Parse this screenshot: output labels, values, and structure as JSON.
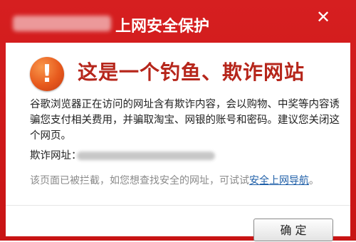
{
  "dialog": {
    "title": "上网安全保护",
    "close_icon": "✕",
    "warning_icon": "!",
    "heading": "这是一个钓鱼、欺诈网站",
    "description": "谷歌浏览器正在访问的网址含有欺诈内容，会以购物、中奖等内容诱骗您支付相关费用，并骗取淘宝、网银的账号和密码。建议您关闭这个网页。",
    "url_label": "欺诈网址：",
    "blocked_text": "该页面已被拦截，如您想查找安全的网址，可试试",
    "safe_nav_link": "安全上网导航",
    "blocked_suffix": "。",
    "ok_button": "确  定"
  },
  "colors": {
    "title_bar": "#d61f20",
    "heading": "#b6261b",
    "link": "#1f5fa8"
  }
}
